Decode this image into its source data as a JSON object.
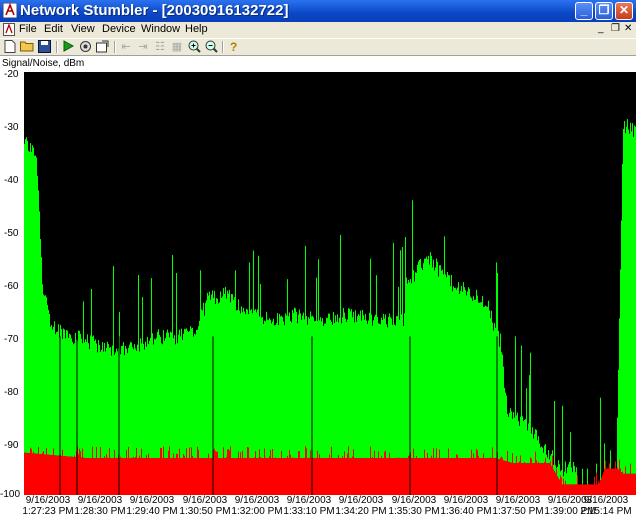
{
  "window": {
    "title": "Network Stumbler - [20030916132722]"
  },
  "menu": [
    "File",
    "Edit",
    "View",
    "Device",
    "Window",
    "Help"
  ],
  "icons": {
    "toolbar": [
      "new-file-icon",
      "open-folder-icon",
      "save-icon",
      "play-icon",
      "scan-options-icon",
      "export-icon",
      "prev-node-icon",
      "next-node-icon",
      "tree-icon",
      "grid-icon",
      "zoom-in-icon",
      "zoom-out-icon",
      "help-icon"
    ]
  },
  "colors": {
    "signal": "#00ff00",
    "noise": "#ff0000",
    "background": "#000000"
  },
  "chart_data": {
    "type": "area",
    "title": "",
    "ylabel": "Signal/Noise, dBm",
    "ylim": [
      -100,
      -20
    ],
    "yticks": [
      -20,
      -30,
      -40,
      -50,
      -60,
      -70,
      -80,
      -90,
      -100
    ],
    "xlabels": [
      [
        "9/16/2003",
        "1:27:23 PM"
      ],
      [
        "9/16/2003",
        "1:28:30 PM"
      ],
      [
        "9/16/2003",
        "1:29:40 PM"
      ],
      [
        "9/16/2003",
        "1:30:50 PM"
      ],
      [
        "9/16/2003",
        "1:32:00 PM"
      ],
      [
        "9/16/2003",
        "1:33:10 PM"
      ],
      [
        "9/16/2003",
        "1:34:20 PM"
      ],
      [
        "9/16/2003",
        "1:35:30 PM"
      ],
      [
        "9/16/2003",
        "1:36:40 PM"
      ],
      [
        "9/16/2003",
        "1:37:50 PM"
      ],
      [
        "9/16/2003",
        "1:39:00 PM"
      ],
      [
        "9/16/2003",
        "2:15:14 PM"
      ]
    ],
    "series": [
      {
        "name": "Signal",
        "profile": [
          [
            0,
            -33
          ],
          [
            0.02,
            -36
          ],
          [
            0.03,
            -60
          ],
          [
            0.045,
            -68
          ],
          [
            0.08,
            -70
          ],
          [
            0.13,
            -72
          ],
          [
            0.155,
            -73
          ],
          [
            0.17,
            -72
          ],
          [
            0.2,
            -71
          ],
          [
            0.22,
            -70
          ],
          [
            0.25,
            -70
          ],
          [
            0.28,
            -69
          ],
          [
            0.3,
            -63
          ],
          [
            0.33,
            -62
          ],
          [
            0.35,
            -64
          ],
          [
            0.38,
            -66
          ],
          [
            0.41,
            -67
          ],
          [
            0.44,
            -66
          ],
          [
            0.48,
            -67
          ],
          [
            0.52,
            -66
          ],
          [
            0.55,
            -66
          ],
          [
            0.58,
            -67
          ],
          [
            0.6,
            -67
          ],
          [
            0.62,
            -67
          ],
          [
            0.625,
            -60
          ],
          [
            0.64,
            -58
          ],
          [
            0.66,
            -55
          ],
          [
            0.7,
            -60
          ],
          [
            0.73,
            -62
          ],
          [
            0.76,
            -64
          ],
          [
            0.77,
            -69
          ],
          [
            0.78,
            -71
          ],
          [
            0.79,
            -84
          ],
          [
            0.83,
            -88
          ],
          [
            0.86,
            -92
          ],
          [
            0.88,
            -95
          ],
          [
            0.94,
            -95
          ],
          [
            0.95,
            -91
          ],
          [
            0.96,
            -92
          ],
          [
            0.97,
            -88
          ],
          [
            0.98,
            -30
          ],
          [
            1.0,
            -31
          ]
        ]
      },
      {
        "name": "Noise",
        "profile": [
          [
            0,
            -92
          ],
          [
            0.1,
            -93
          ],
          [
            0.3,
            -93
          ],
          [
            0.5,
            -93
          ],
          [
            0.6,
            -93
          ],
          [
            0.7,
            -93
          ],
          [
            0.77,
            -93
          ],
          [
            0.8,
            -94
          ],
          [
            0.86,
            -94
          ],
          [
            0.88,
            -98
          ],
          [
            0.94,
            -98
          ],
          [
            0.95,
            -95
          ],
          [
            0.97,
            -95
          ],
          [
            0.98,
            -96
          ],
          [
            1.0,
            -96
          ]
        ]
      }
    ]
  }
}
